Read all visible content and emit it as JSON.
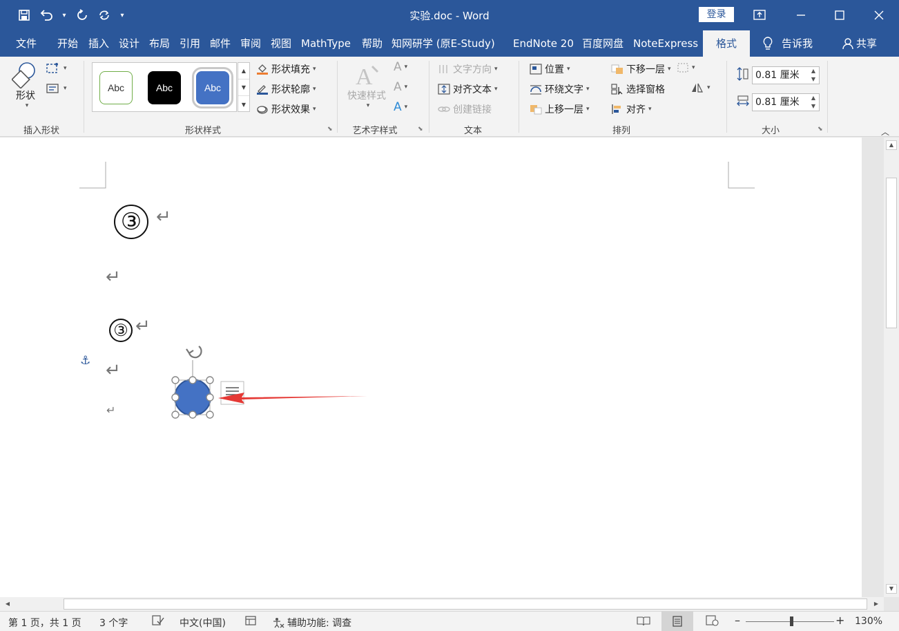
{
  "window": {
    "title": "实验.doc  -  Word",
    "login_label": "登录"
  },
  "quick_access": {
    "icons": [
      "save-icon",
      "undo-icon",
      "redo-icon",
      "repeat-icon",
      "customize-icon"
    ]
  },
  "tabs": [
    {
      "label": "文件"
    },
    {
      "label": "开始"
    },
    {
      "label": "插入"
    },
    {
      "label": "设计"
    },
    {
      "label": "布局"
    },
    {
      "label": "引用"
    },
    {
      "label": "邮件"
    },
    {
      "label": "审阅"
    },
    {
      "label": "视图"
    },
    {
      "label": "MathType"
    },
    {
      "label": "帮助"
    },
    {
      "label": "知网研学 (原E-Study)"
    },
    {
      "label": "EndNote 20"
    },
    {
      "label": "百度网盘"
    },
    {
      "label": "NoteExpress"
    },
    {
      "label": "格式",
      "active": true
    }
  ],
  "tell_me": "告诉我",
  "share": "共享",
  "ribbon": {
    "insert_shapes": {
      "label": "插入形状",
      "shapes_button": "形状"
    },
    "shape_styles": {
      "label": "形状样式",
      "gallery": [
        "Abc",
        "Abc",
        "Abc"
      ],
      "fill": "形状填充",
      "outline": "形状轮廓",
      "effects": "形状效果"
    },
    "wordart": {
      "label": "艺术字样式",
      "quick_styles": "快速样式"
    },
    "text": {
      "label": "文本",
      "direction": "文字方向",
      "align_text": "对齐文本",
      "create_link": "创建链接"
    },
    "arrange": {
      "label": "排列",
      "position": "位置",
      "wrap_text": "环绕文字",
      "bring_forward": "上移一层",
      "send_backward": "下移一层",
      "selection_pane": "选择窗格",
      "align": "对齐"
    },
    "size": {
      "label": "大小",
      "height": "0.81 厘米",
      "width": "0.81 厘米"
    }
  },
  "document": {
    "circled_large": "③",
    "circled_small": "③",
    "para_mark": "↵"
  },
  "status_bar": {
    "page": "第 1 页，共 1 页",
    "words": "3 个字",
    "language": "中文(中国)",
    "accessibility": "辅助功能: 调查",
    "zoom": "130%"
  },
  "colors": {
    "brand": "#2b579a",
    "shape_fill": "#4472c4",
    "arrow": "#e53935"
  }
}
